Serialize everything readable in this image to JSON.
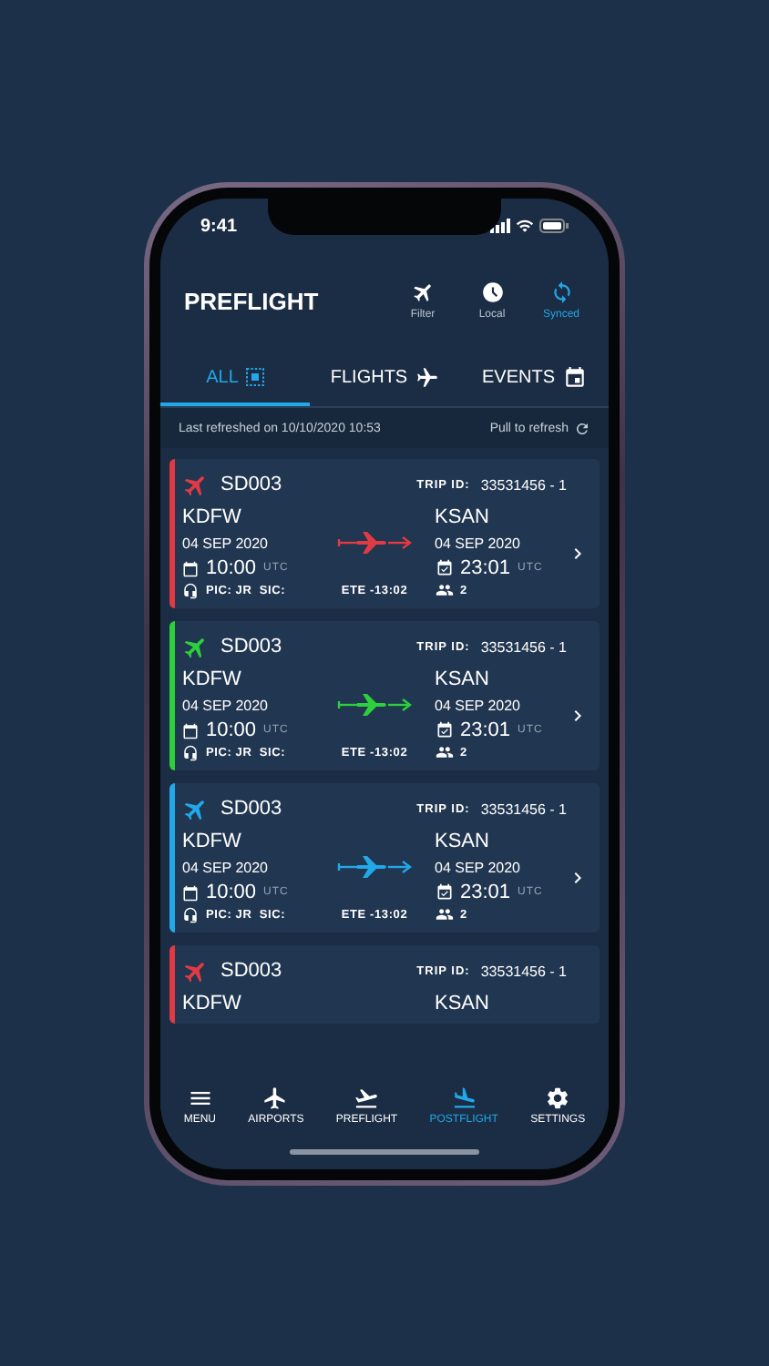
{
  "status_bar": {
    "time": "9:41"
  },
  "header": {
    "title": "PREFLIGHT",
    "actions": [
      {
        "kind": "plane",
        "label": "Filter",
        "active": false
      },
      {
        "kind": "clock",
        "label": "Local",
        "active": false
      },
      {
        "kind": "sync",
        "label": "Synced",
        "active": true
      }
    ]
  },
  "tabs": [
    {
      "kind": "grid",
      "label": "ALL",
      "selected": true
    },
    {
      "kind": "plane",
      "label": "FLIGHTS",
      "selected": false
    },
    {
      "kind": "calendar",
      "label": "EVENTS",
      "selected": false
    }
  ],
  "refresh": {
    "last_refreshed": "Last refreshed on 10/10/2020 10:53",
    "action": "Pull to refresh"
  },
  "trips": [
    {
      "color": "#e23a44",
      "code": "SD003",
      "trip_id_label": "TRIP ID:",
      "trip_id": "33531456 - 1",
      "origin": "KDFW",
      "origin_date": "04 SEP 2020",
      "departure_time": "10:00",
      "departure_zone": "UTC",
      "crew": "PIC: JR  SIC:",
      "ete": "ETE -13:02",
      "destination": "KSAN",
      "destination_date": "04 SEP 2020",
      "arrival_time": "23:01",
      "arrival_zone": "UTC",
      "passengers": "2"
    },
    {
      "color": "#2ccf3c",
      "code": "SD003",
      "trip_id_label": "TRIP ID:",
      "trip_id": "33531456 - 1",
      "origin": "KDFW",
      "origin_date": "04 SEP 2020",
      "departure_time": "10:00",
      "departure_zone": "UTC",
      "crew": "PIC: JR  SIC:",
      "ete": "ETE -13:02",
      "destination": "KSAN",
      "destination_date": "04 SEP 2020",
      "arrival_time": "23:01",
      "arrival_zone": "UTC",
      "passengers": "2"
    },
    {
      "color": "#22a8e8",
      "code": "SD003",
      "trip_id_label": "TRIP ID:",
      "trip_id": "33531456 - 1",
      "origin": "KDFW",
      "origin_date": "04 SEP 2020",
      "departure_time": "10:00",
      "departure_zone": "UTC",
      "crew": "PIC: JR  SIC:",
      "ete": "ETE -13:02",
      "destination": "KSAN",
      "destination_date": "04 SEP 2020",
      "arrival_time": "23:01",
      "arrival_zone": "UTC",
      "passengers": "2"
    },
    {
      "color": "#e23a44",
      "code": "SD003",
      "trip_id_label": "TRIP ID:",
      "trip_id": "33531456 - 1",
      "origin": "KDFW",
      "destination": "KSAN"
    }
  ],
  "nav": [
    {
      "kind": "menu",
      "label": "MENU",
      "selected": false
    },
    {
      "kind": "airports",
      "label": "AIRPORTS",
      "selected": false
    },
    {
      "kind": "takeoff",
      "label": "PREFLIGHT",
      "selected": false
    },
    {
      "kind": "landing",
      "label": "POSTFLIGHT",
      "selected": true
    },
    {
      "kind": "settings",
      "label": "SETTINGS",
      "selected": false
    }
  ]
}
